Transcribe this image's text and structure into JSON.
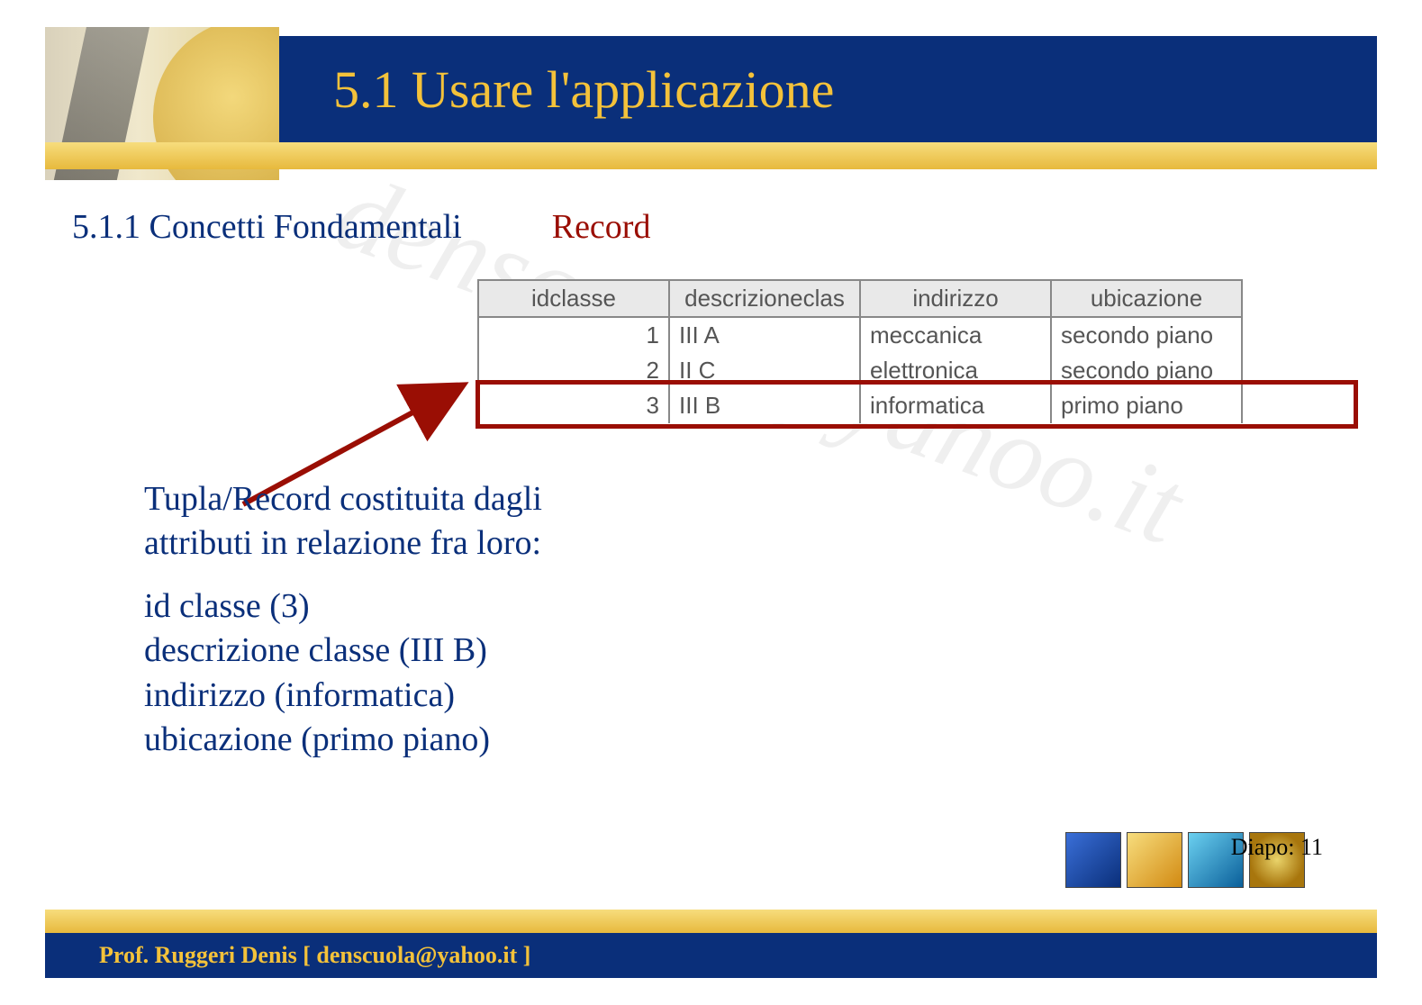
{
  "header": {
    "title": "5.1 Usare l'applicazione"
  },
  "subtitle": {
    "left": "5.1.1 Concetti Fondamentali",
    "right": "Record"
  },
  "table": {
    "headers": [
      "idclasse",
      "descrizioneclas",
      "indirizzo",
      "ubicazione"
    ],
    "rows": [
      {
        "id": "1",
        "desc": "III A",
        "ind": "meccanica",
        "ubi": "secondo piano"
      },
      {
        "id": "2",
        "desc": "II C",
        "ind": "elettronica",
        "ubi": "secondo piano"
      },
      {
        "id": "3",
        "desc": "III B",
        "ind": "informatica",
        "ubi": "primo piano"
      }
    ],
    "highlighted_row_index": 2
  },
  "body": {
    "p1_l1": "Tupla/Record costituita dagli",
    "p1_l2": "attributi in relazione fra loro:",
    "p2_l1": "id classe (3)",
    "p2_l2": "descrizione classe (III B)",
    "p2_l3": "indirizzo (informatica)",
    "p2_l4": "ubicazione (primo piano)"
  },
  "watermark": "denscuola@yahoo.it",
  "footer": {
    "diapo_label": "Diapo:",
    "diapo_num": "11",
    "author": "Prof. Ruggeri Denis  [ denscuola@yahoo.it ]"
  }
}
